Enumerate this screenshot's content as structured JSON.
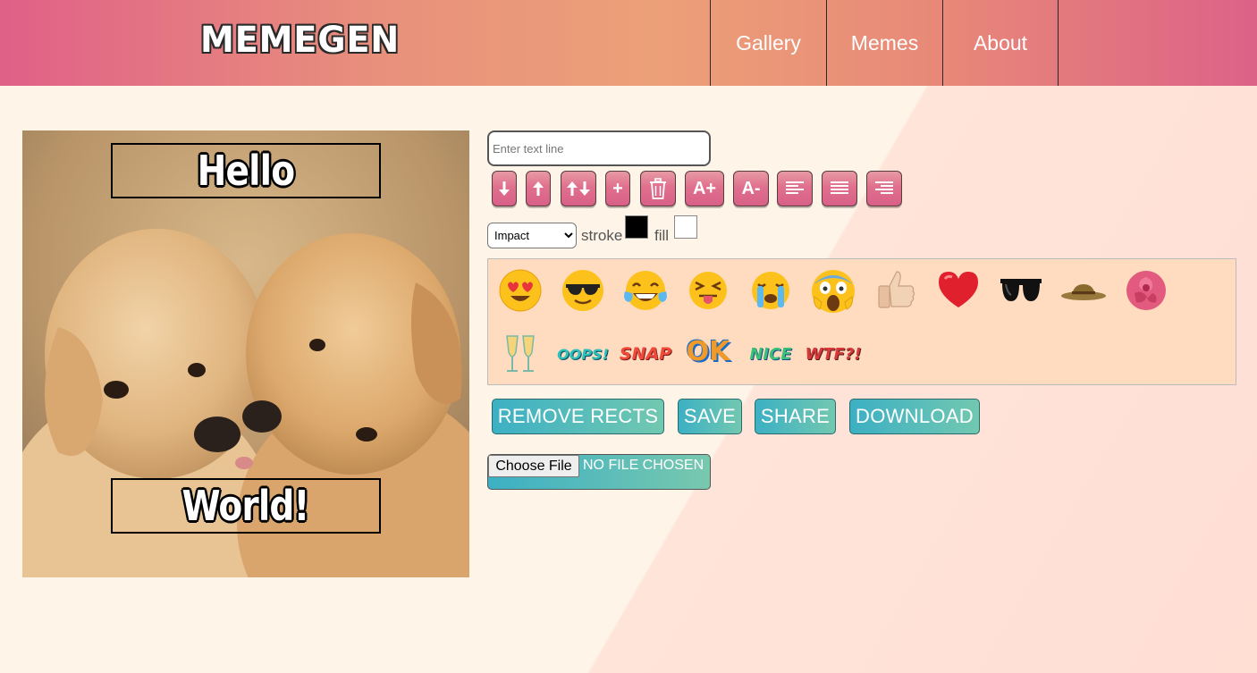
{
  "header": {
    "logo": "MEMEGEN",
    "nav": [
      "Gallery",
      "Memes",
      "About"
    ]
  },
  "canvas": {
    "top_text": "Hello",
    "bottom_text": "World!"
  },
  "editor": {
    "text_placeholder": "Enter text line",
    "tools": [
      {
        "name": "move-down-button",
        "label": "",
        "icon": "arrow-down-icon"
      },
      {
        "name": "move-up-button",
        "label": "",
        "icon": "arrow-up-icon"
      },
      {
        "name": "switch-lines-button",
        "label": "",
        "icon": "swap-vertical-icon"
      },
      {
        "name": "add-line-button",
        "label": "+",
        "icon": "plus-icon"
      },
      {
        "name": "delete-line-button",
        "label": "",
        "icon": "trash-icon"
      },
      {
        "name": "increase-font-button",
        "label": "A+",
        "icon": ""
      },
      {
        "name": "decrease-font-button",
        "label": "A-",
        "icon": ""
      },
      {
        "name": "align-left-button",
        "label": "",
        "icon": "align-left-icon"
      },
      {
        "name": "align-center-button",
        "label": "",
        "icon": "align-center-icon"
      },
      {
        "name": "align-right-button",
        "label": "",
        "icon": "align-right-icon"
      }
    ],
    "font_options": [
      "Impact"
    ],
    "font_selected": "Impact",
    "stroke_label": "stroke",
    "fill_label": "fill",
    "stroke_color": "#000000",
    "fill_color": "#ffffff"
  },
  "stickers": {
    "emoji": [
      "heart-eyes-emoji",
      "sunglasses-emoji",
      "tears-of-joy-emoji",
      "squinting-tongue-emoji",
      "crying-emoji",
      "screaming-emoji",
      "thumbs-up-emoji",
      "red-heart-emoji",
      "black-sunglasses",
      "hat",
      "rose"
    ],
    "words": [
      "OOPS!",
      "SNAP",
      "OK",
      "NICE",
      "WTF?!"
    ],
    "toast": "champagne-glasses"
  },
  "actions": {
    "remove_rects": "REMOVE RECTS",
    "save": "SAVE",
    "share": "SHARE",
    "download": "DOWNLOAD"
  },
  "file": {
    "button": "Choose File",
    "status": "NO FILE CHOSEN"
  },
  "colors": {
    "tool_button": "#e0708e",
    "action_button_start": "#3cb0c4",
    "action_button_end": "#72c8b0",
    "sticker_panel": "#ffdcc0"
  }
}
